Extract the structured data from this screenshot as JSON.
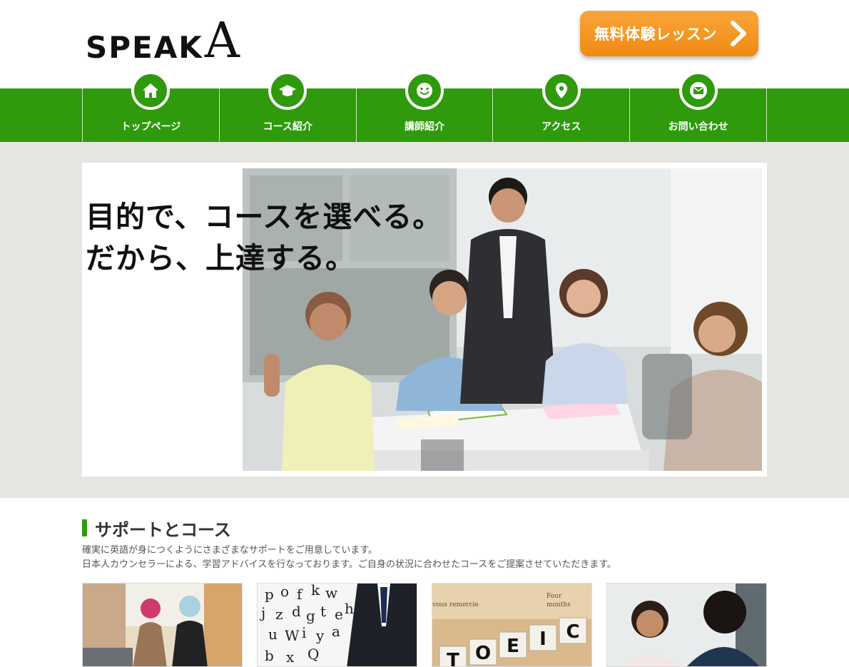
{
  "header": {
    "logo_text": "SPEAK",
    "logo_letter": "A",
    "cta_label": "無料体験レッスン"
  },
  "nav": {
    "items": [
      {
        "label": "トップページ",
        "icon": "home-icon"
      },
      {
        "label": "コース紹介",
        "icon": "graduation-cap-icon"
      },
      {
        "label": "講師紹介",
        "icon": "smile-icon"
      },
      {
        "label": "アクセス",
        "icon": "map-pin-icon"
      },
      {
        "label": "お問い合わせ",
        "icon": "envelope-icon"
      }
    ]
  },
  "hero": {
    "line1": "目的で、コースを選べる。",
    "line2": "だから、上達する。"
  },
  "section": {
    "title": "サポートとコース",
    "desc_line1": "確実に英語が身につくようにさまざまなサポートをご用意しています。",
    "desc_line2": "日本人カウンセラーによる、学習アドバイスを行なっております。ご自身の状況に合わせたコースをご提案させていただきます。"
  },
  "cards": {
    "toeic_tiles": [
      "T",
      "O",
      "E",
      "I",
      "C"
    ],
    "newspaper_words": [
      "Four",
      "months",
      "vous remercie"
    ],
    "letters": [
      "p",
      "o",
      "f",
      "k",
      "w",
      "j",
      "z",
      "d",
      "g",
      "t",
      "e",
      "h",
      "u",
      "W",
      "i",
      "y",
      "a",
      "b",
      "x",
      "Q"
    ]
  },
  "colors": {
    "brand_green": "#2f9a0c",
    "cta_orange": "#f39214",
    "hero_band": "#e6e5e0"
  }
}
